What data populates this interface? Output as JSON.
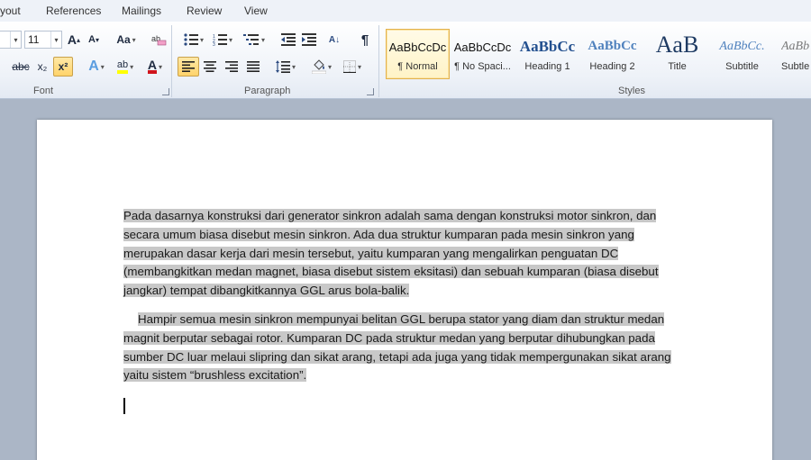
{
  "tabs": [
    "yout",
    "References",
    "Mailings",
    "Review",
    "View"
  ],
  "font": {
    "size": "11",
    "group_label": "Font",
    "grow_label": "A",
    "shrink_label": "A",
    "case_label": "Aa",
    "strike_label": "abc",
    "subscript_label": "x₂",
    "superscript_label": "x²",
    "effects_label": "A",
    "highlight_label": "ab",
    "color_label": "A"
  },
  "paragraph": {
    "group_label": "Paragraph",
    "sort_label": "A↓",
    "pilcrow_label": "¶"
  },
  "styles": {
    "group_label": "Styles",
    "items": [
      {
        "sample": "AaBbCcDc",
        "name": "¶ Normal"
      },
      {
        "sample": "AaBbCcDc",
        "name": "¶ No Spaci..."
      },
      {
        "sample": "AaBbCc",
        "name": "Heading 1"
      },
      {
        "sample": "AaBbCc",
        "name": "Heading 2"
      },
      {
        "sample": "AaB",
        "name": "Title"
      },
      {
        "sample": "AaBbCc.",
        "name": "Subtitle"
      },
      {
        "sample": "AaBbC",
        "name": "Subtle"
      }
    ]
  },
  "colors": {
    "accent": "#e3b24d",
    "highlight": "#c8c8c8",
    "font_color": "#d0141c",
    "highlight_color": "#ffff00"
  },
  "document": {
    "paragraph1": "Pada dasarnya konstruksi dari generator sinkron adalah sama dengan konstruksi motor sinkron, dan secara umum biasa disebut mesin sinkron. Ada dua struktur kumparan pada mesin sinkron yang merupakan dasar kerja dari mesin tersebut, yaitu kumparan yang mengalirkan penguatan DC (membangkitkan medan magnet, biasa disebut sistem eksitasi) dan sebuah kumparan (biasa disebut jangkar) tempat dibangkitkannya GGL arus bola-balik.",
    "paragraph2": "Hampir semua mesin sinkron mempunyai belitan GGL berupa stator yang diam dan struktur medan magnit berputar sebagai rotor. Kumparan DC pada struktur medan yang berputar dihubungkan pada sumber DC luar melaui slipring dan sikat arang, tetapi ada juga yang tidak mempergunakan sikat arang yaitu sistem “brushless excitation”."
  }
}
